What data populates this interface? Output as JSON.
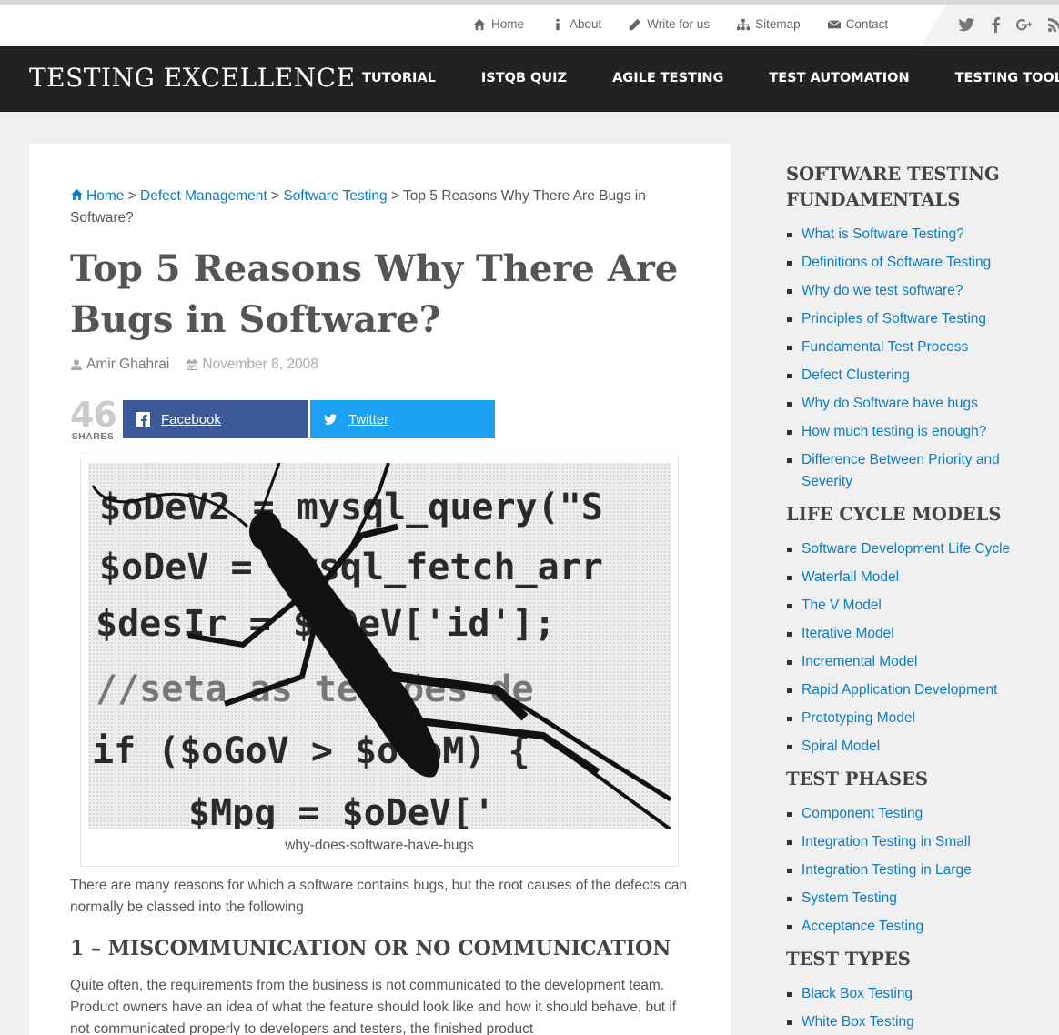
{
  "topnav": {
    "items": [
      {
        "label": "Home",
        "icon": "home-icon"
      },
      {
        "label": "About",
        "icon": "info-icon"
      },
      {
        "label": "Write for us",
        "icon": "pencil-icon"
      },
      {
        "label": "Sitemap",
        "icon": "sitemap-icon"
      },
      {
        "label": "Contact",
        "icon": "envelope-icon"
      }
    ],
    "social": [
      "twitter-icon",
      "facebook-icon",
      "google-plus-icon",
      "rss-icon"
    ]
  },
  "header": {
    "logo": "TESTING EXCELLENCE",
    "nav": [
      "TUTORIAL",
      "ISTQB QUIZ",
      "AGILE TESTING",
      "TEST AUTOMATION",
      "TESTING TOOLS"
    ]
  },
  "article": {
    "breadcrumb": {
      "home": "Home",
      "sep": ">",
      "crumb1": "Defect Management",
      "crumb2": "Software Testing",
      "current": "Top 5 Reasons Why There Are Bugs in Software?"
    },
    "title": "Top 5 Reasons Why There Are Bugs in Software?",
    "author": "Amir Ghahrai",
    "date": "November 8, 2008",
    "shares_count": "46",
    "shares_label": "SHARES",
    "facebook_label": "Facebook",
    "twitter_label": "Twitter",
    "image_caption": "why-does-software-have-bugs",
    "image_code_lines": [
      "$oDeV2 = mysql_query(\"S",
      "$oDeV = mysql_fetch_arr",
      "$desIr = $oDeV['id'];",
      "//seta as tercões de",
      "if ($oGoV > $oGoM) {",
      "$Mpg = $oDeV['"
    ],
    "intro": "There are many reasons for which a software contains bugs, but the root causes of the defects can normally be classed into the following",
    "heading1": "1 – MISCOMMUNICATION OR NO COMMUNICATION",
    "para1": "Quite often, the requirements from the business is not communicated to the development team. Product owners have an idea of what the feature should look like and how it should behave, but if not communicated properly to developers and testers, the finished product"
  },
  "sidebar": {
    "widgets": [
      {
        "title": "SOFTWARE TESTING FUNDAMENTALS",
        "links": [
          "What is Software Testing?",
          "Definitions of Software Testing",
          "Why do we test software?",
          "Principles of Software Testing",
          "Fundamental Test Process",
          "Defect Clustering",
          "Why do Software have bugs",
          "How much testing is enough?",
          "Difference Between Priority and Severity"
        ]
      },
      {
        "title": "LIFE CYCLE MODELS",
        "links": [
          "Software Development Life Cycle",
          "Waterfall Model",
          "The V Model",
          "Iterative Model",
          "Incremental Model",
          "Rapid Application Development",
          "Prototyping Model",
          "Spiral Model"
        ]
      },
      {
        "title": "TEST PHASES",
        "links": [
          "Component Testing",
          "Integration Testing in Small",
          "Integration Testing in Large",
          "System Testing",
          "Acceptance Testing"
        ]
      },
      {
        "title": "TEST TYPES",
        "links": [
          "Black Box Testing",
          "White Box Testing"
        ]
      }
    ]
  },
  "colors": {
    "link": "#0b7dc4",
    "header_bg": "#222222",
    "facebook": "#3b5998",
    "twitter": "#1da1f2"
  }
}
